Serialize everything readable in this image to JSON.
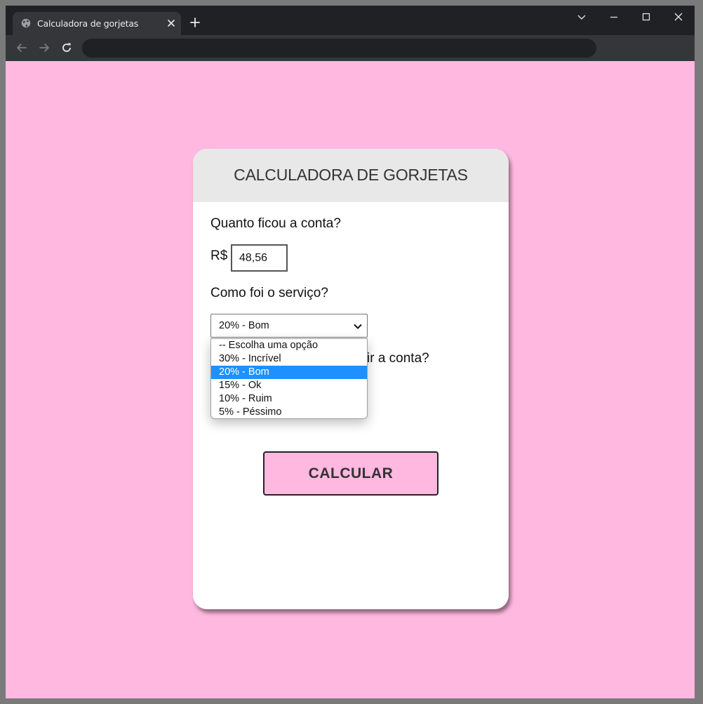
{
  "browser": {
    "tab_title": "Calculadora de gorjetas",
    "url": ""
  },
  "app": {
    "title": "CALCULADORA DE GORJETAS",
    "bill_question": "Quanto ficou a conta?",
    "currency_label": "R$",
    "bill_value": "48,56",
    "service_question": "Como foi o serviço?",
    "service_selected": "20% - Bom",
    "service_options": [
      "-- Escolha uma opção",
      "30% - Incrível",
      "20% - Bom",
      "15% - Ok",
      "10% - Ruim",
      "5% - Péssimo"
    ],
    "split_question_fragment": "ir a conta?",
    "calculate_label": "CALCULAR"
  },
  "colors": {
    "page_background": "#ffb8e0",
    "card_header": "#e8e8e8",
    "option_highlight": "#1e90ff"
  }
}
